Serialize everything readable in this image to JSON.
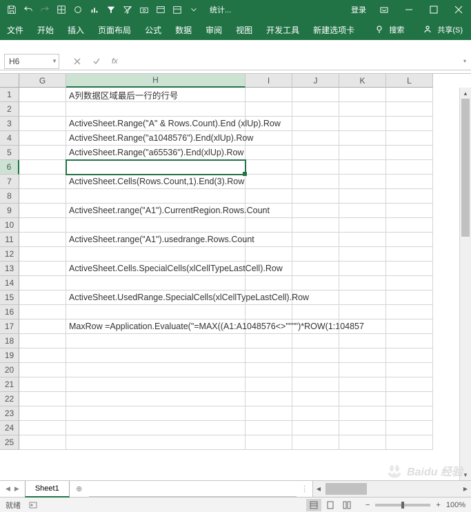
{
  "titlebar": {
    "title": "统计...",
    "login": "登录"
  },
  "ribbon": {
    "tabs": [
      "文件",
      "开始",
      "插入",
      "页面布局",
      "公式",
      "数据",
      "审阅",
      "视图",
      "开发工具",
      "新建选项卡"
    ],
    "search": "搜索",
    "share": "共享(S)"
  },
  "namebox": "H6",
  "formula": "",
  "columns": [
    "G",
    "H",
    "I",
    "J",
    "K",
    "L"
  ],
  "rows": [
    1,
    2,
    3,
    4,
    5,
    6,
    7,
    8,
    9,
    10,
    11,
    12,
    13,
    14,
    15,
    16,
    17,
    18,
    19,
    20,
    21,
    22,
    23,
    24,
    25
  ],
  "active": {
    "row": 6,
    "col": "H"
  },
  "cells": {
    "H1": "A列数据区域最后一行的行号",
    "H3": "ActiveSheet.Range(\"A\" & Rows.Count).End (xlUp).Row",
    "H4": "ActiveSheet.Range(\"a1048576\").End(xlUp).Row",
    "H5": "ActiveSheet.Range(\"a65536\").End(xlUp).Row",
    "H7": "ActiveSheet.Cells(Rows.Count,1).End(3).Row",
    "H9": "ActiveSheet.range(\"A1\").CurrentRegion.Rows.Count",
    "H11": "ActiveSheet.range(\"A1\").usedrange.Rows.Count",
    "H13": "ActiveSheet.Cells.SpecialCells(xlCellTypeLastCell).Row",
    "H15": "ActiveSheet.UsedRange.SpecialCells(xlCellTypeLastCell).Row",
    "H17": "MaxRow =Application.Evaluate(\"=MAX((A1:A1048576<>\"\"\"\")*ROW(1:104857"
  },
  "sheet": {
    "active": "Sheet1"
  },
  "status": {
    "mode": "就绪",
    "zoom": "100%"
  },
  "watermark": "Baidu 经验"
}
